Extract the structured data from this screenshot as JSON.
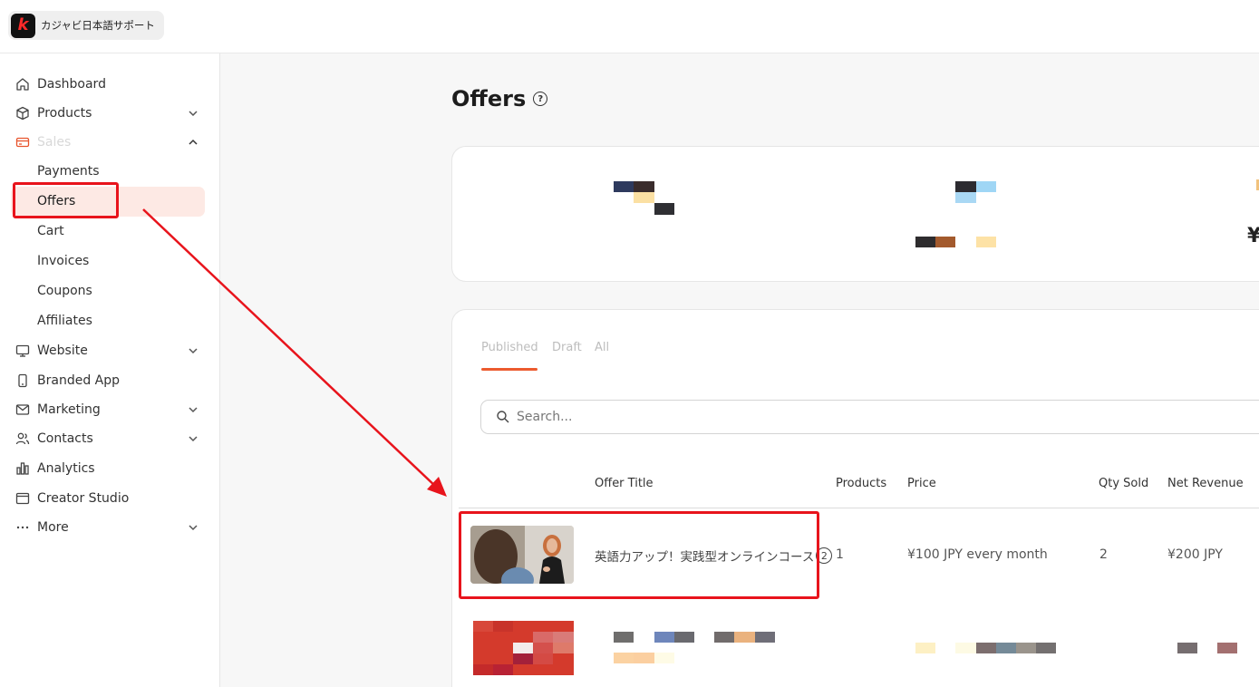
{
  "brand": {
    "name": "カジャビ日本語サポート",
    "logo_letter": "k",
    "logo_color": "#ff2a2a"
  },
  "sidebar": {
    "items": [
      {
        "label": "Dashboard",
        "icon": "home-icon"
      },
      {
        "label": "Products",
        "icon": "box-icon"
      },
      {
        "label": "Sales",
        "icon": "credit-card-icon"
      },
      {
        "label": "Website",
        "icon": "monitor-icon"
      },
      {
        "label": "Branded App",
        "icon": "phone-icon"
      },
      {
        "label": "Marketing",
        "icon": "mail-icon"
      },
      {
        "label": "Contacts",
        "icon": "users-icon"
      },
      {
        "label": "Analytics",
        "icon": "bar-chart-icon"
      },
      {
        "label": "Creator Studio",
        "icon": "browser-icon"
      },
      {
        "label": "More",
        "icon": "dots-icon"
      }
    ],
    "sales_sub": [
      "Payments",
      "Offers",
      "Cart",
      "Invoices",
      "Coupons",
      "Affiliates"
    ],
    "active": "Offers"
  },
  "page": {
    "title": "Offers",
    "help_glyph": "?"
  },
  "stats": {
    "currency_glyph": "¥"
  },
  "tabs": [
    "Published",
    "Draft",
    "All"
  ],
  "search": {
    "placeholder": "Search..."
  },
  "table": {
    "headers": [
      "Offer Title",
      "Products",
      "Price",
      "Qty Sold",
      "Net Revenue"
    ],
    "rows": [
      {
        "title": "英語力アップ！実践型オンラインコース",
        "title_badge": "2",
        "products": "1",
        "price": "¥100 JPY every month",
        "qty_sold": "2",
        "net_revenue": "¥200 JPY"
      }
    ]
  },
  "colors": {
    "accent": "#ec5a2e",
    "annotation": "#e8141c",
    "active_bg": "#fde9e4"
  }
}
